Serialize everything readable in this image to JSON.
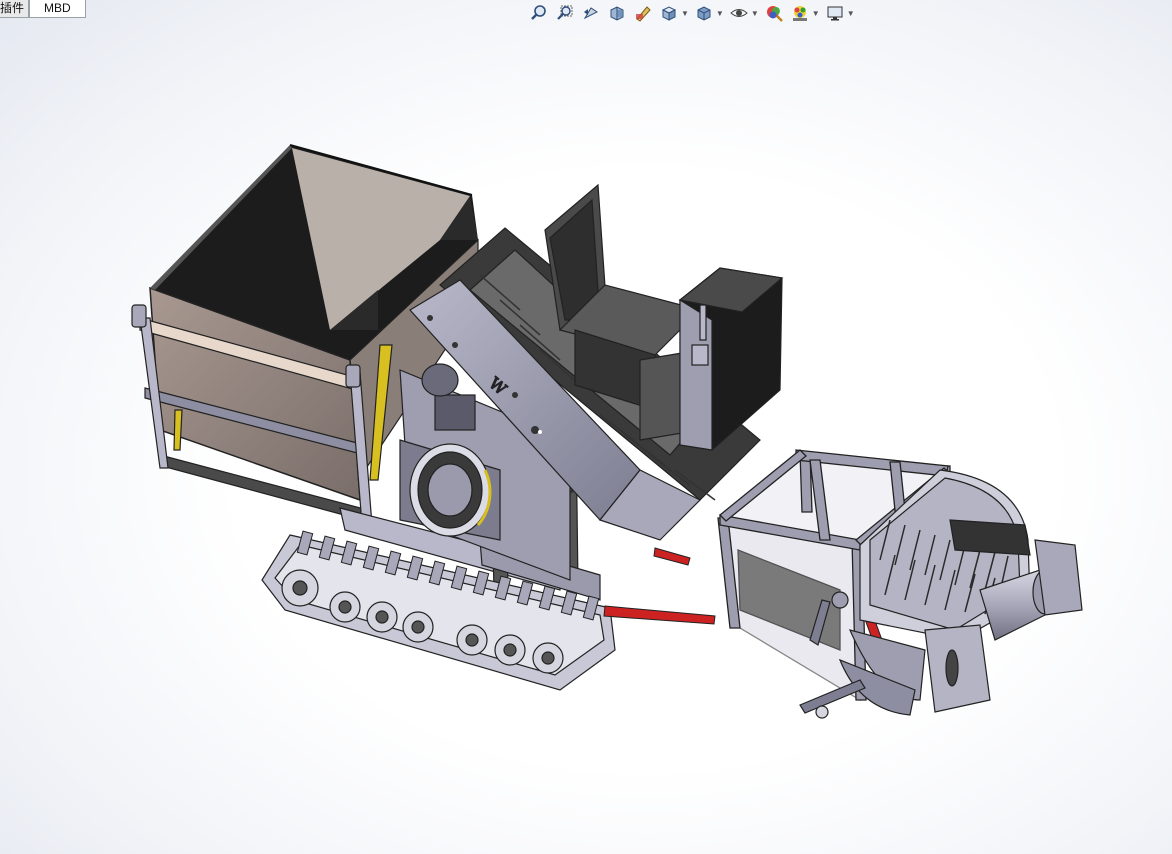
{
  "tabs": [
    {
      "label": "插件"
    },
    {
      "label": "MBD"
    }
  ],
  "heads_up_toolbar": [
    {
      "icon": "zoom-to-fit-icon"
    },
    {
      "icon": "zoom-to-area-icon"
    },
    {
      "icon": "previous-view-icon"
    },
    {
      "icon": "section-view-icon"
    },
    {
      "icon": "dynamic-annotation-icon"
    },
    {
      "icon": "view-orientation-icon",
      "dropdown": true
    },
    {
      "icon": "display-style-icon",
      "dropdown": true
    },
    {
      "icon": "hide-show-items-icon",
      "dropdown": true
    },
    {
      "icon": "edit-appearance-icon"
    },
    {
      "icon": "apply-scene-icon",
      "dropdown": true
    },
    {
      "icon": "view-settings-icon",
      "dropdown": true
    }
  ],
  "model": {
    "colors": {
      "body": "#8c8c9e",
      "body_light": "#b6b6c8",
      "dark": "#3c3c3c",
      "bin_inside": "#b9b0aa",
      "hydraulic_red": "#cc2222",
      "cylinder_yellow": "#d8c020"
    }
  }
}
